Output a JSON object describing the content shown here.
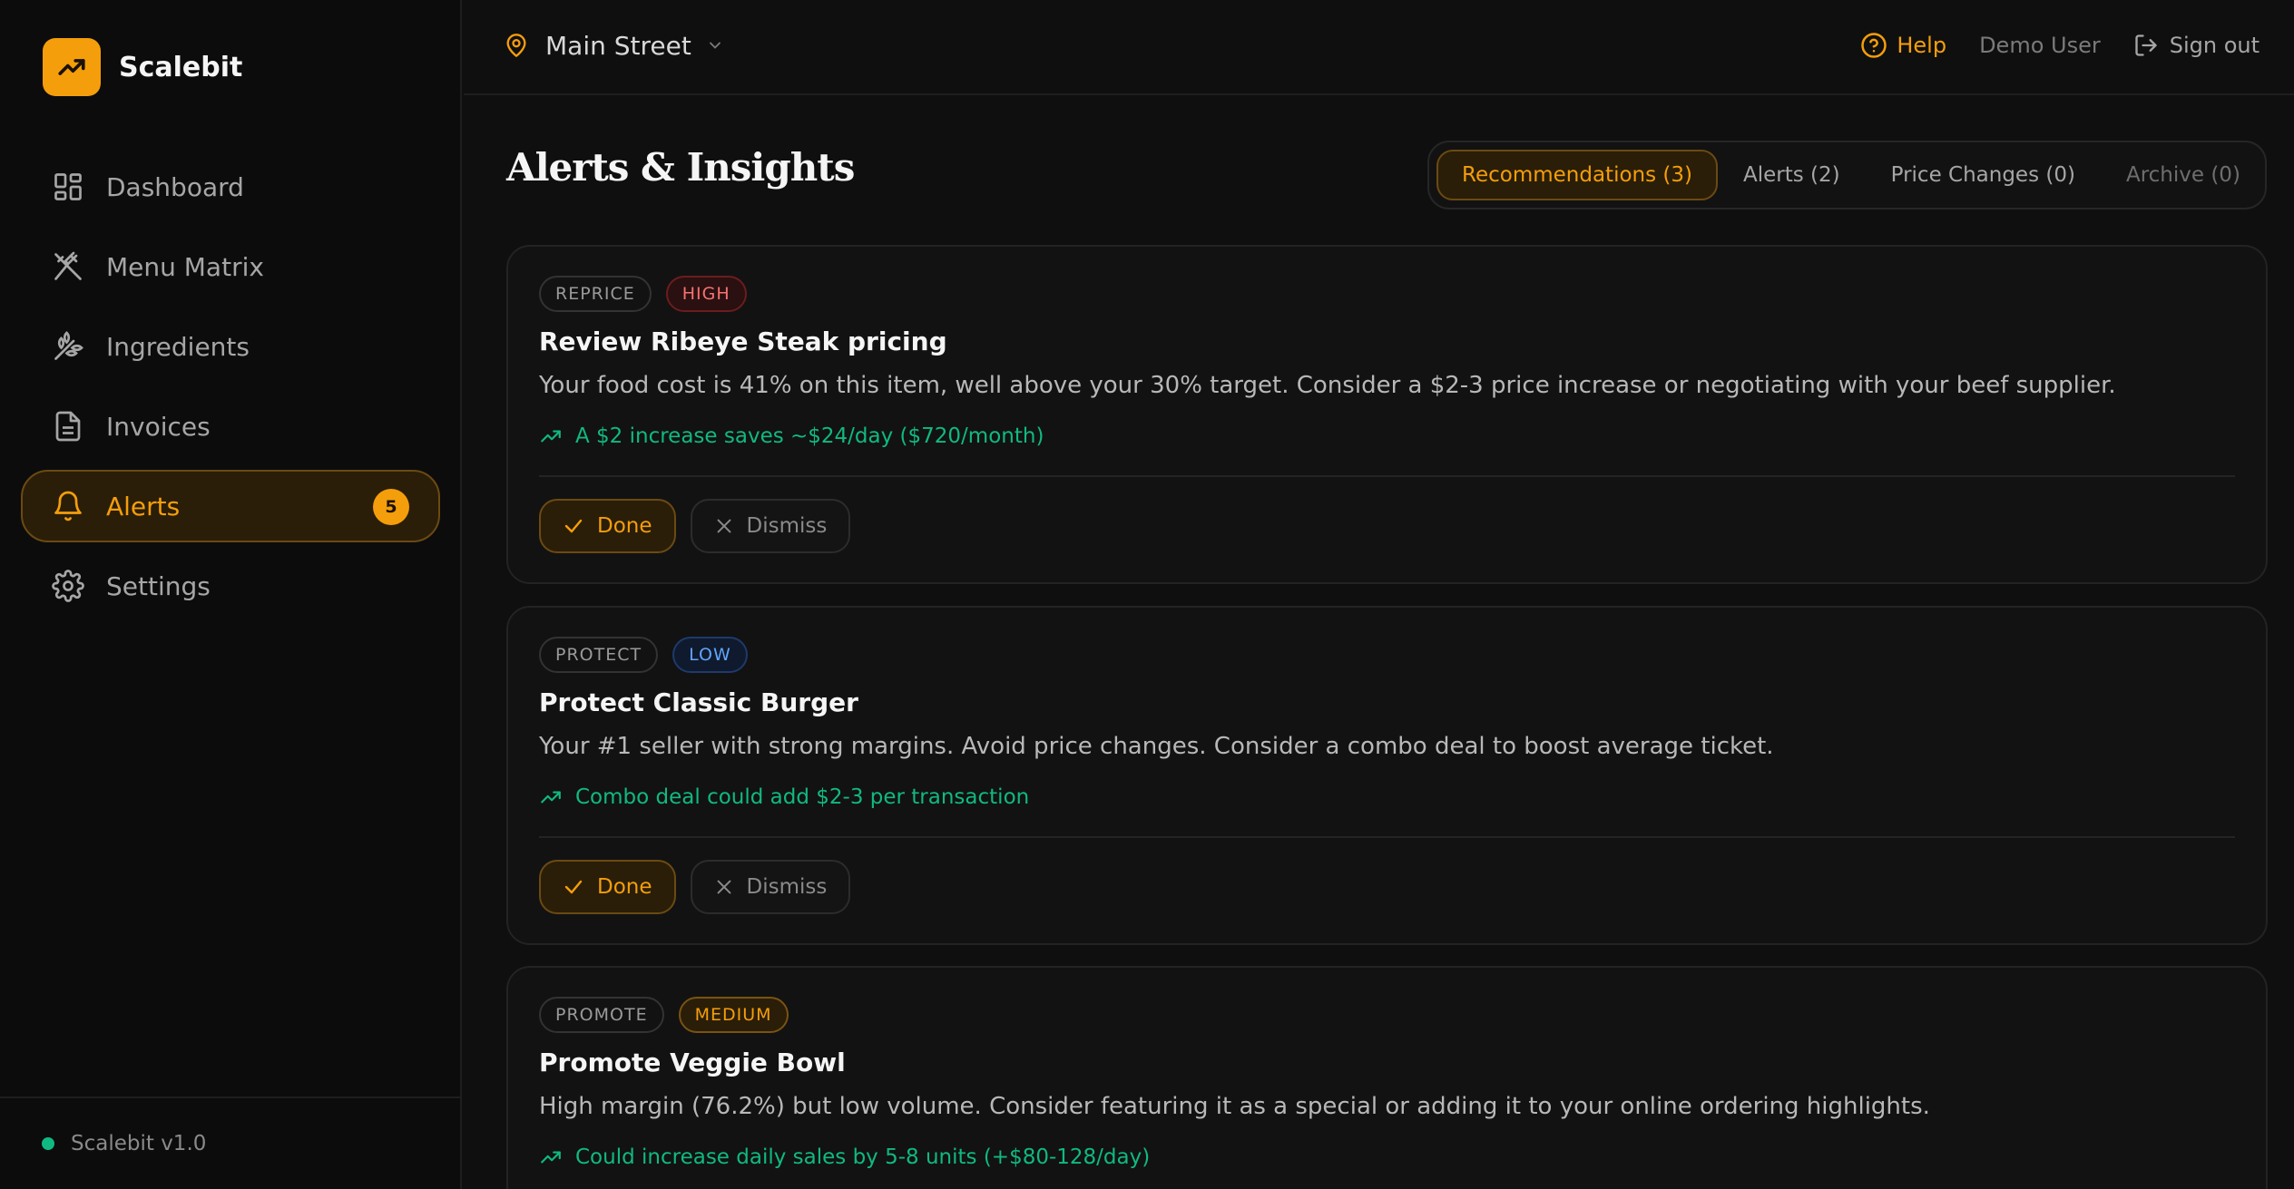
{
  "brand": {
    "name": "Scalebit",
    "version": "Scalebit v1.0"
  },
  "nav": {
    "items": [
      {
        "label": "Dashboard",
        "icon": "dashboard-icon"
      },
      {
        "label": "Menu Matrix",
        "icon": "utensils-crossed-icon"
      },
      {
        "label": "Ingredients",
        "icon": "wheat-icon"
      },
      {
        "label": "Invoices",
        "icon": "file-text-icon"
      },
      {
        "label": "Alerts",
        "icon": "bell-icon",
        "badge": "5",
        "active": true
      },
      {
        "label": "Settings",
        "icon": "gear-icon"
      }
    ]
  },
  "topbar": {
    "location": "Main Street",
    "help": "Help",
    "user": "Demo User",
    "sign_out": "Sign out"
  },
  "page": {
    "title": "Alerts & Insights",
    "tabs": [
      {
        "label": "Recommendations (3)",
        "active": true
      },
      {
        "label": "Alerts (2)"
      },
      {
        "label": "Price Changes (0)"
      },
      {
        "label": "Archive (0)"
      }
    ]
  },
  "cards": [
    {
      "type": "REPRICE",
      "priority": "HIGH",
      "title": "Review Ribeye Steak pricing",
      "description": "Your food cost is 41% on this item, well above your 30% target. Consider a $2-3 price increase or negotiating with your beef supplier.",
      "impact": "A $2 increase saves ~$24/day ($720/month)",
      "done": "Done",
      "dismiss": "Dismiss"
    },
    {
      "type": "PROTECT",
      "priority": "LOW",
      "title": "Protect Classic Burger",
      "description": "Your #1 seller with strong margins. Avoid price changes. Consider a combo deal to boost average ticket.",
      "impact": "Combo deal could add $2-3 per transaction",
      "done": "Done",
      "dismiss": "Dismiss"
    },
    {
      "type": "PROMOTE",
      "priority": "MEDIUM",
      "title": "Promote Veggie Bowl",
      "description": "High margin (76.2%) but low volume. Consider featuring it as a special or adding it to your online ordering highlights.",
      "impact": "Could increase daily sales by 5-8 units (+$80-128/day)"
    }
  ],
  "colors": {
    "accent": "#f59e0b",
    "positive": "#10b981",
    "high": "#f87171",
    "low": "#60a5fa"
  }
}
